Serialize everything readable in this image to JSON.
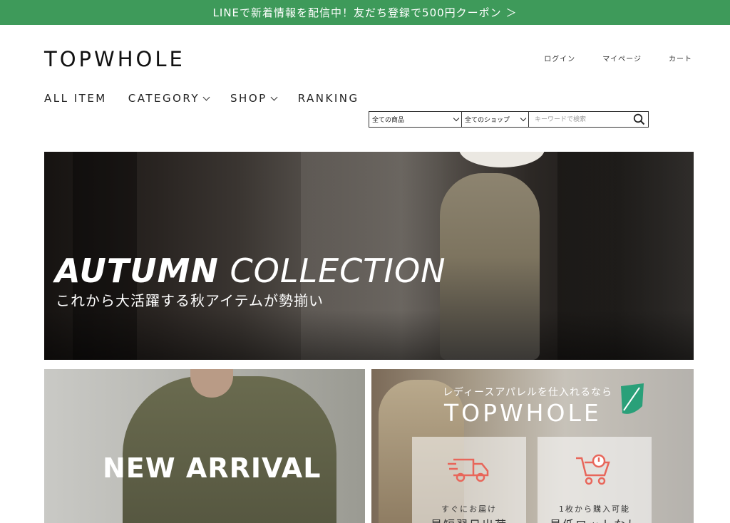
{
  "promo": {
    "text": "LINEで新着情報を配信中！友だち登録で500円クーポン ＞"
  },
  "header": {
    "logo": "TOPWHOLE"
  },
  "util_nav": {
    "login": "ログイン",
    "mypage": "マイページ",
    "cart": "カート"
  },
  "main_nav": {
    "all_item": "ALL ITEM",
    "category": "CATEGORY",
    "shop": "SHOP",
    "ranking": "RANKING"
  },
  "search": {
    "category_selected": "全ての商品",
    "shop_selected": "全てのショップ",
    "placeholder": "キーワードで検索"
  },
  "hero": {
    "title_bold": "AUTUMN",
    "title_light": "COLLECTION",
    "subtitle": "これから大活躍する秋アイテムが勢揃い"
  },
  "tile_new_arrival": {
    "title": "NEW ARRIVAL"
  },
  "tile_about": {
    "subtitle": "レディースアパレルを仕入れるなら",
    "brand": "TOPWHOLE",
    "feature_1_caption": "すぐにお届け",
    "feature_1_title": "最短翌日出荷",
    "feature_2_caption": "1枚から購入可能",
    "feature_2_title": "最低ロットなし"
  },
  "colors": {
    "promo_green": "#3e9a5a",
    "icon_red": "#e8665a",
    "leaf_green": "#2aa079"
  }
}
